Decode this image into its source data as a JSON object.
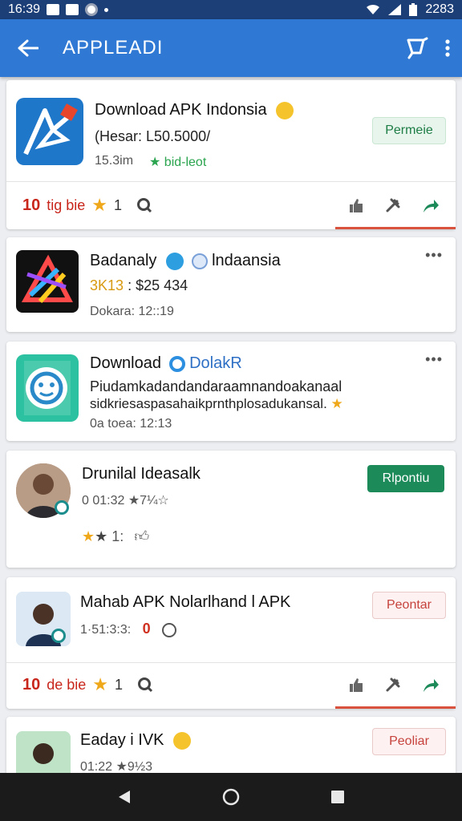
{
  "status": {
    "time": "16:39",
    "battery": "2283"
  },
  "appbar": {
    "title": "APPLEADI",
    "back_icon": "arrow-left-icon",
    "share_icon": "crop-icon",
    "more_icon": "more-vert-icon"
  },
  "cards": [
    {
      "title": "Download APK Indonsia",
      "subtitle": "(Hesar: L50.5000/",
      "meta": "15.3im",
      "badge": "★ bid-leot",
      "button": "Permeie",
      "footer": {
        "count": "10",
        "label": "tig bie",
        "rating": "1"
      }
    },
    {
      "title": "Badanaly",
      "title2": "lndaansia",
      "subtitle_a": "3K13",
      "subtitle_b": ": $25 434",
      "meta": "Dokara: 12::19"
    },
    {
      "title": "Download",
      "title2": "DolakR",
      "line1": "Piudamkadandandaraamnandoakanaal",
      "line2": "sidkriesaspasahaikprnthplosadukansal.",
      "meta": "0a toea: 12:13"
    },
    {
      "title": "Drunilal Ideasalk",
      "meta": "0 01:32  ★7¼☆",
      "rating": "1:",
      "button": "Rlpontiu"
    },
    {
      "title": "Mahab APK Nolarlhand l APK",
      "meta": "1·51:3:3:",
      "count": "0",
      "button": "Peontar",
      "footer": {
        "count": "10",
        "label": "de bie",
        "rating": "1"
      }
    },
    {
      "title": "Eaday i IVK",
      "meta": "01:22  ★9½3",
      "button": "Peoliar"
    }
  ],
  "colors": {
    "appbar": "#2f79d4",
    "statusbar": "#1d3f78",
    "accent_red": "#c8261b",
    "accent_green": "#1d8a5a"
  }
}
